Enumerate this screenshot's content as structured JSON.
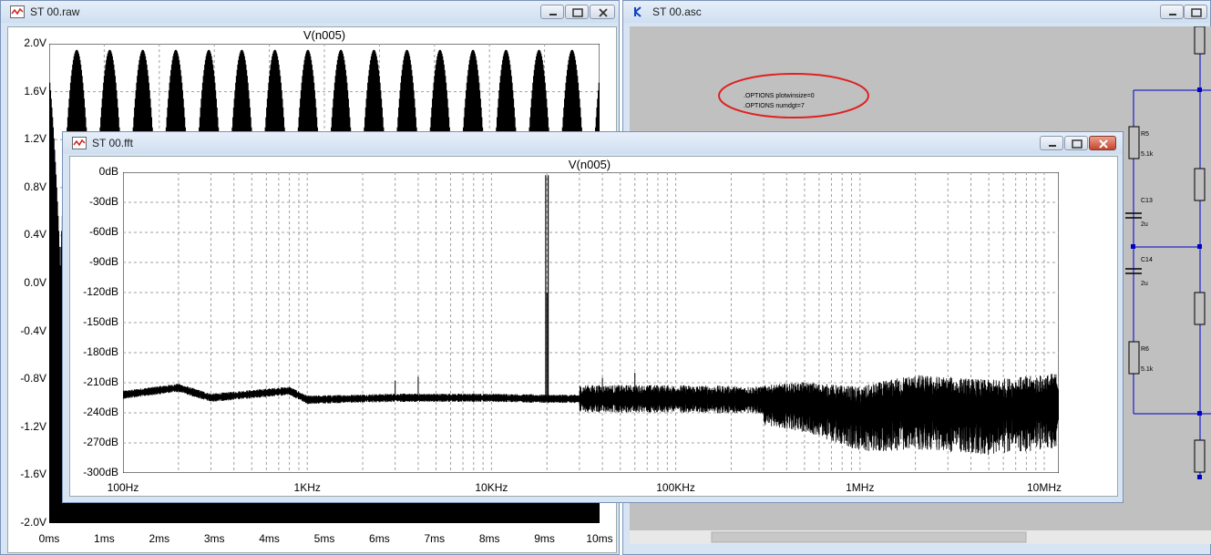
{
  "windows": {
    "raw": {
      "title": "ST 00.raw",
      "trace_name": "V(n005)",
      "y_ticks": [
        "2.0V",
        "1.6V",
        "1.2V",
        "0.8V",
        "0.4V",
        "0.0V",
        "-0.4V",
        "-0.8V",
        "-1.2V",
        "-1.6V",
        "-2.0V"
      ],
      "x_ticks": [
        "0ms",
        "1ms",
        "2ms",
        "3ms",
        "4ms",
        "5ms",
        "6ms",
        "7ms",
        "8ms",
        "9ms",
        "10ms"
      ]
    },
    "asc": {
      "title": "ST 00.asc",
      "directives": [
        ".OPTIONS plotwinsize=0",
        ".OPTIONS numdgt=7"
      ],
      "components": [
        {
          "ref": "R5",
          "value": "5.1k"
        },
        {
          "ref": "C13",
          "value": "2u"
        },
        {
          "ref": "C14",
          "value": "2u"
        },
        {
          "ref": "R6",
          "value": "5.1k"
        }
      ]
    },
    "fft": {
      "title": "ST 00.fft",
      "trace_name": "V(n005)",
      "y_ticks": [
        "0dB",
        "-30dB",
        "-60dB",
        "-90dB",
        "-120dB",
        "-150dB",
        "-180dB",
        "-210dB",
        "-240dB",
        "-270dB",
        "-300dB"
      ],
      "x_ticks": [
        "100Hz",
        "1KHz",
        "10KHz",
        "100KHz",
        "1MHz",
        "10MHz"
      ]
    }
  },
  "colors": {
    "annotation_circle": "#e02020",
    "wire": "#0000c8",
    "trace": "#000000",
    "grid": "#a0a0a0",
    "schematic_bg": "#c0c0c0"
  },
  "chart_data": [
    {
      "type": "line",
      "title": "V(n005)",
      "x_unit": "ms",
      "xlim": [
        0,
        10
      ],
      "ylim": [
        -2.0,
        2.0
      ],
      "y_unit": "V",
      "grid": true,
      "description_values": {
        "peak_approx": 1.95,
        "trough_approx": -2.0
      }
    },
    {
      "type": "line",
      "title": "V(n005)",
      "x_scale": "log",
      "xlim": [
        100,
        12000000
      ],
      "ylim": [
        -300,
        0
      ],
      "y_unit": "dB",
      "grid": true,
      "fundamental_hz": 20000,
      "fundamental_db": -3,
      "noise_floor_db": [
        [
          100,
          -222
        ],
        [
          200,
          -215
        ],
        [
          300,
          -225
        ],
        [
          800,
          -218
        ],
        [
          1000,
          -227
        ],
        [
          3000,
          -225
        ],
        [
          10000,
          -225
        ],
        [
          20000,
          -226
        ],
        [
          100000,
          -226
        ],
        [
          500000,
          -228
        ],
        [
          1000000,
          -238
        ],
        [
          2000000,
          -230
        ],
        [
          5000000,
          -235
        ],
        [
          10000000,
          -230
        ],
        [
          12000000,
          -228
        ]
      ],
      "spurs": [
        [
          3000,
          -208
        ],
        [
          4000,
          -204
        ],
        [
          20000,
          -120
        ],
        [
          40000,
          -205
        ],
        [
          60000,
          -200
        ]
      ]
    }
  ]
}
